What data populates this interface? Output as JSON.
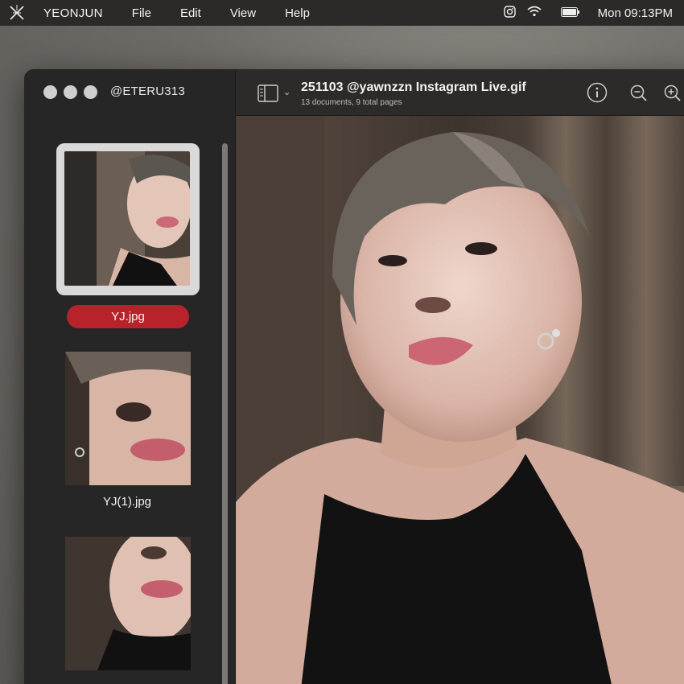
{
  "menubar": {
    "app_name": "YEONJUN",
    "menus": [
      "File",
      "Edit",
      "View",
      "Help"
    ],
    "clock": "Mon  09:13PM"
  },
  "sidebar": {
    "account": "@ETERU313",
    "items": [
      {
        "label": "YJ.jpg",
        "selected": true
      },
      {
        "label": "YJ(1).jpg",
        "selected": false
      },
      {
        "label": "",
        "selected": false
      }
    ]
  },
  "toolbar": {
    "title": "251103 @yawnzzn Instagram Live.gif",
    "subtitle": "13 documents, 9 total pages"
  },
  "colors": {
    "accent": "#b8232b",
    "menubar": "#2b2a29",
    "window": "#242323"
  },
  "icons": [
    "app-logo-icon",
    "instagram-icon",
    "wifi-icon",
    "battery-icon",
    "sidebar-toggle-icon",
    "chevron-down-icon",
    "info-icon",
    "zoom-out-icon",
    "zoom-in-icon"
  ]
}
